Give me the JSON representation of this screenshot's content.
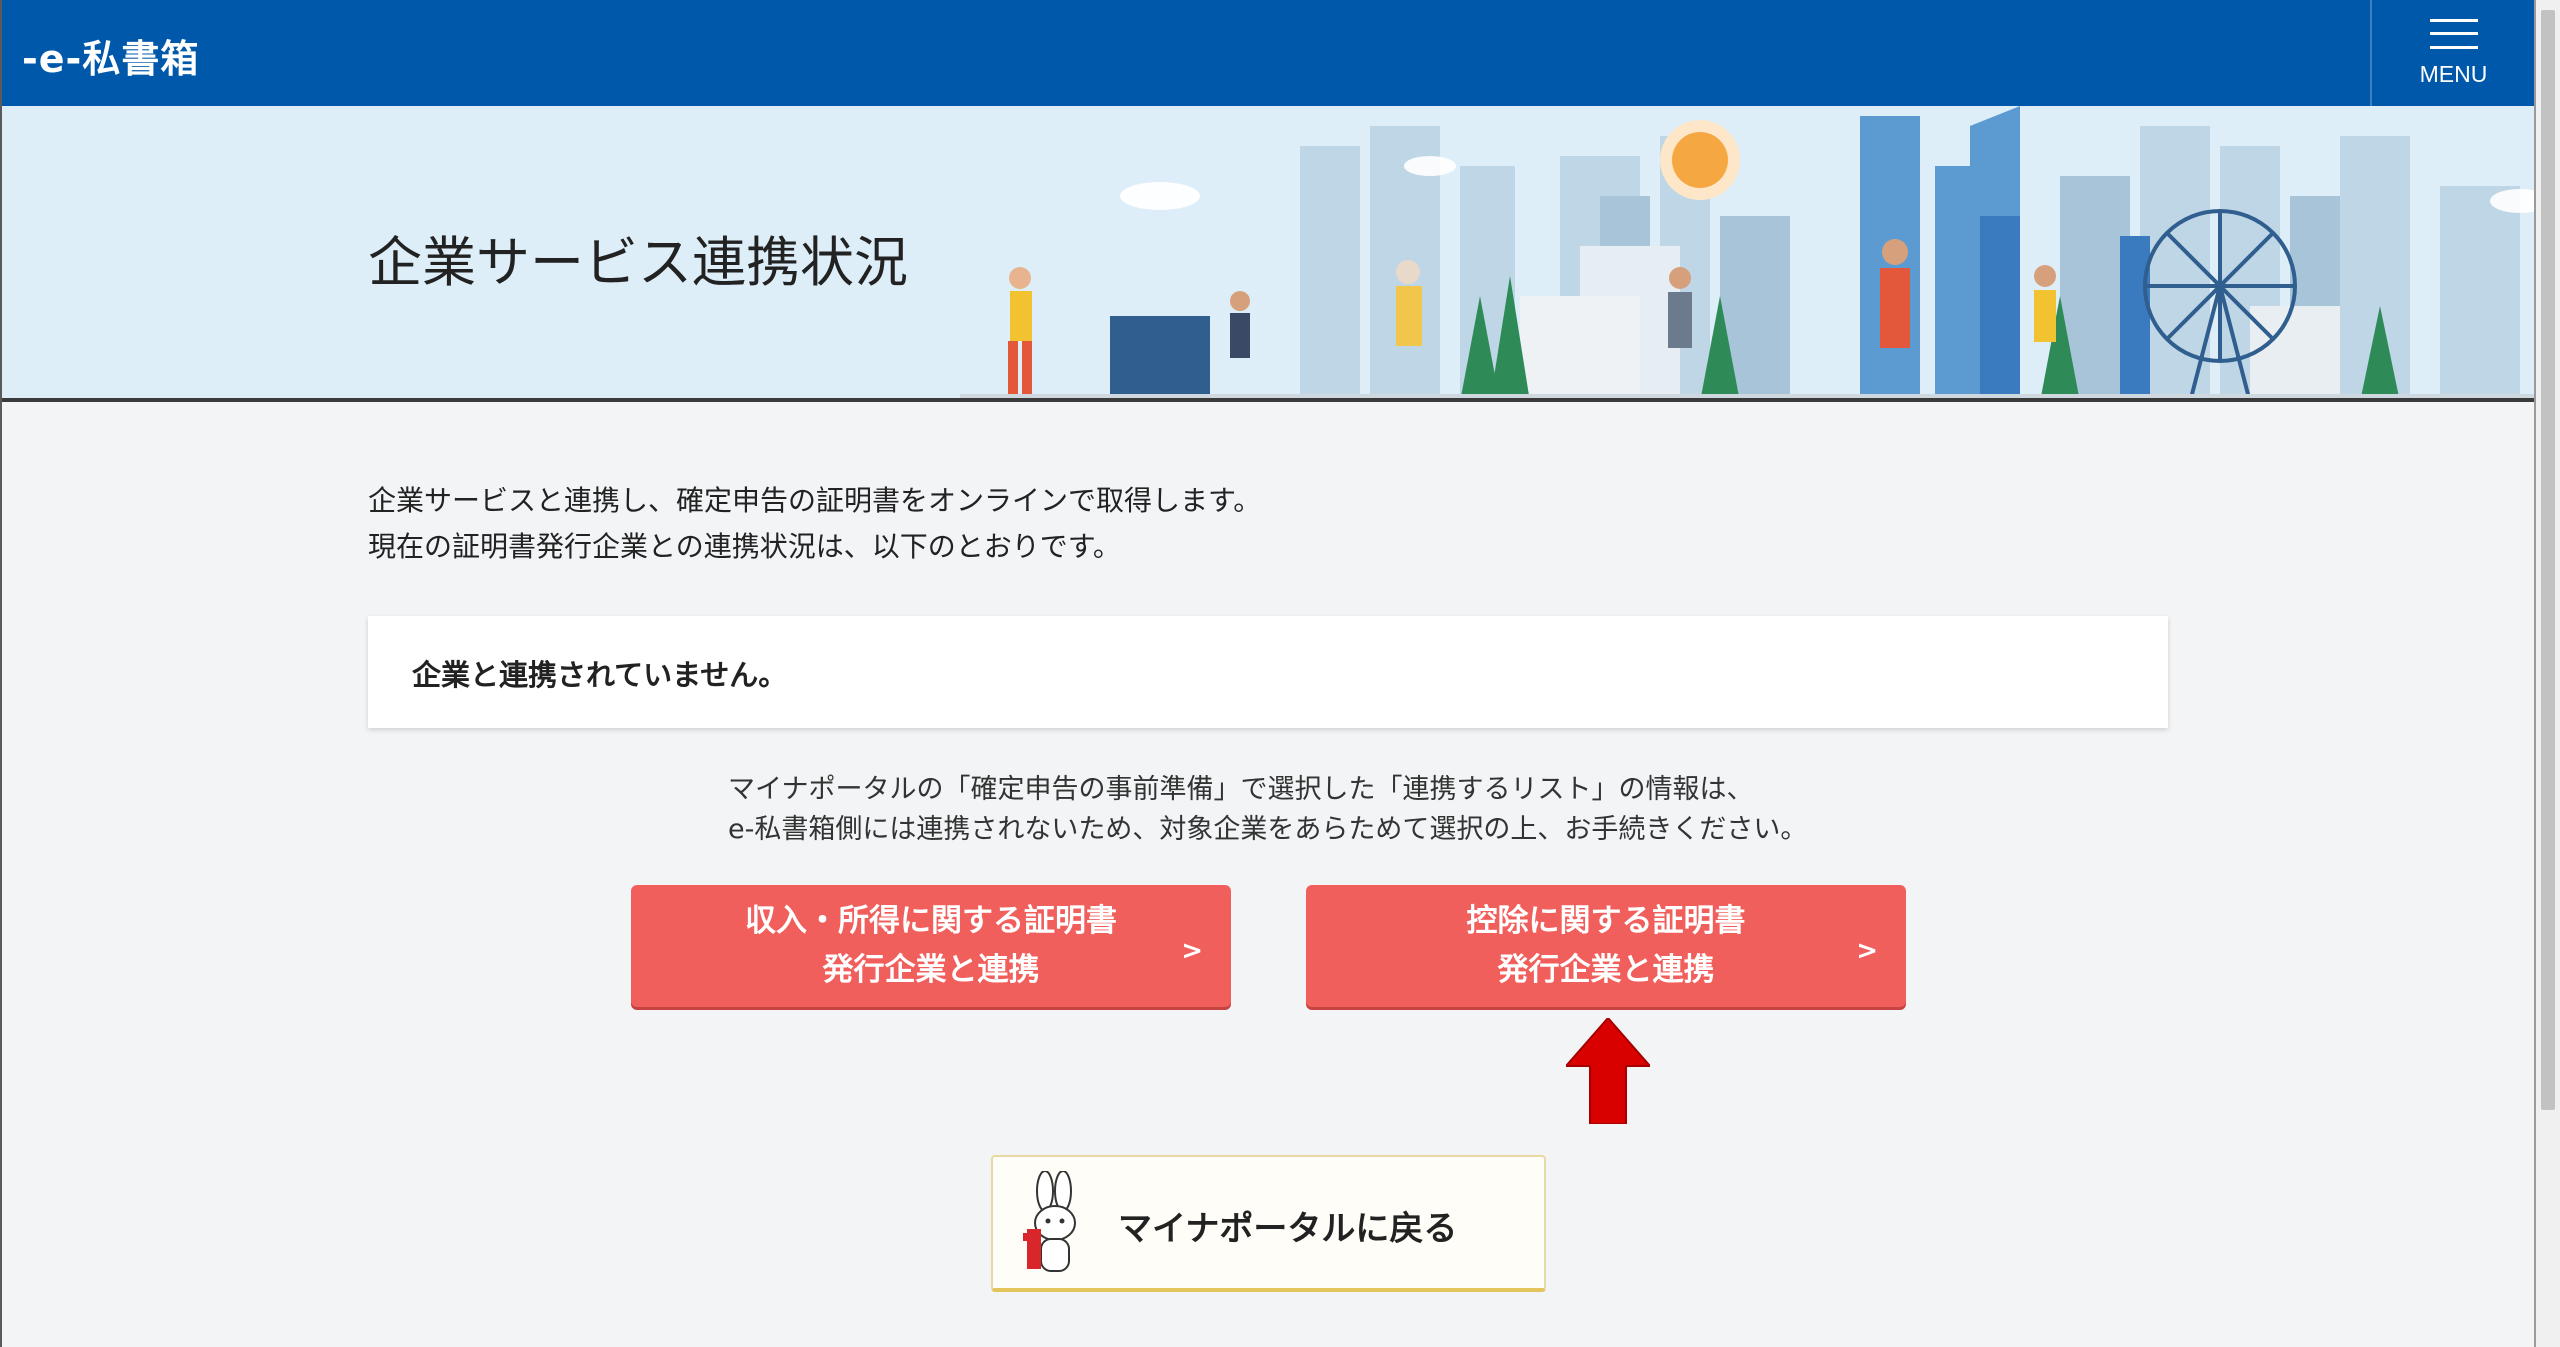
{
  "header": {
    "logo": "-e-私書箱",
    "menu_label": "MENU"
  },
  "hero": {
    "title": "企業サービス連携状況"
  },
  "intro": {
    "line1": "企業サービスと連携し、確定申告の証明書をオンラインで取得します。",
    "line2": "現在の証明書発行企業との連携状況は、以下のとおりです。"
  },
  "status": {
    "text": "企業と連携されていません。"
  },
  "note": {
    "line1": "マイナポータルの「確定申告の事前準備」で選択した「連携するリスト」の情報は、",
    "line2": "e-私書箱側には連携されないため、対象企業をあらためて選択の上、お手続きください。"
  },
  "buttons": {
    "income": {
      "line1": "収入・所得に関する証明書",
      "line2": "発行企業と連携",
      "chevron": ">"
    },
    "deduction": {
      "line1": "控除に関する証明書",
      "line2": "発行企業と連携",
      "chevron": ">"
    }
  },
  "back": {
    "label": "マイナポータルに戻る"
  },
  "colors": {
    "header": "#0058ab",
    "button": "#f15f5c",
    "arrow": "#d90000",
    "back_border": "#e3c55c"
  }
}
